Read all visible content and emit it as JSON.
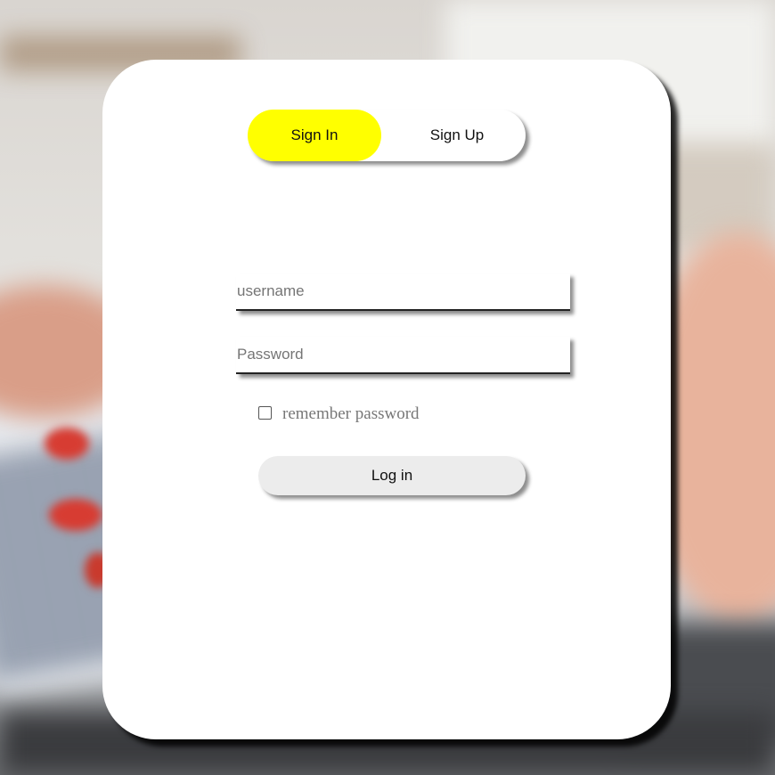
{
  "tabs": {
    "sign_in": "Sign In",
    "sign_up": "Sign Up",
    "active": "sign_in"
  },
  "form": {
    "username_placeholder": "username",
    "username_value": "",
    "password_placeholder": "Password",
    "password_value": "",
    "remember_label": "remember password",
    "remember_checked": false,
    "login_label": "Log in"
  },
  "colors": {
    "active_tab": "#ffff00",
    "card": "#ffffff",
    "login_button": "#ececec"
  }
}
